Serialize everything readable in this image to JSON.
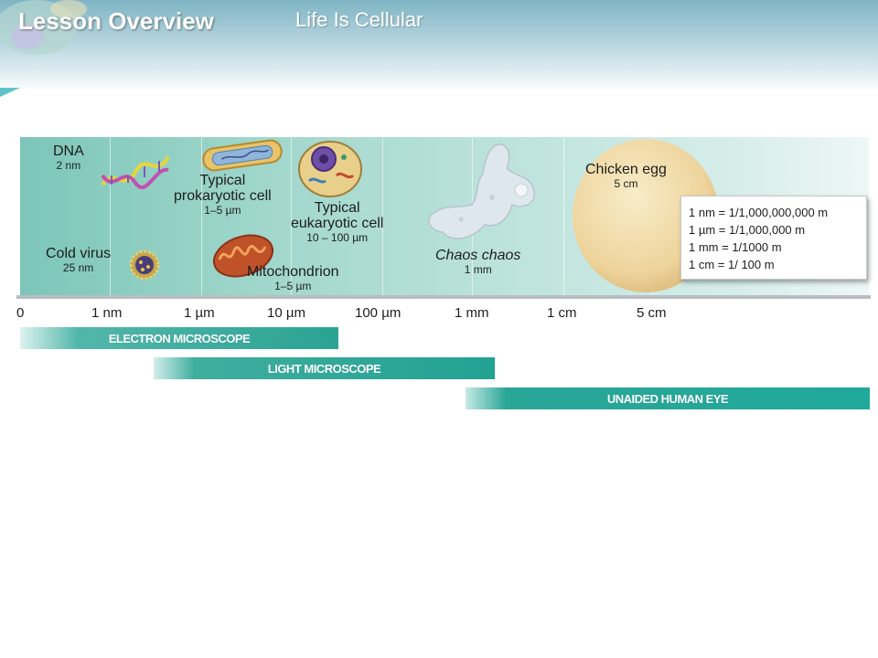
{
  "header": {
    "lesson_title": "Lesson Overview",
    "subtitle": "Life Is Cellular"
  },
  "figure": {
    "objects": [
      {
        "name": "DNA",
        "size": "2 nm"
      },
      {
        "name": "Cold virus",
        "size": "25 nm"
      },
      {
        "name": "Typical prokaryotic cell",
        "name_line1": "Typical",
        "name_line2": "prokaryotic cell",
        "size": "1–5 µm"
      },
      {
        "name": "Mitochondrion",
        "size": "1–5 µm"
      },
      {
        "name": "Typical eukaryotic cell",
        "name_line1": "Typical",
        "name_line2": "eukaryotic cell",
        "size": "10 – 100 µm"
      },
      {
        "name": "Chaos chaos",
        "size": "1 mm"
      },
      {
        "name": "Chicken egg",
        "size": "5 cm"
      }
    ],
    "scale_ticks": [
      "0",
      "1 nm",
      "1 µm",
      "10 µm",
      "100 µm",
      "1 mm",
      "1 cm",
      "5 cm"
    ],
    "units": [
      "1 nm = 1/1,000,000,000 m",
      "1 µm = 1/1,000,000 m",
      "1 mm = 1/1000 m",
      "1 cm = 1/ 100 m"
    ],
    "ranges": [
      {
        "label": "ELECTRON MICROSCOPE",
        "from": "0",
        "to": "100 µm"
      },
      {
        "label": "LIGHT MICROSCOPE",
        "from": "1 µm",
        "to": "1 mm"
      },
      {
        "label": "UNAIDED HUMAN EYE",
        "from": "1 mm",
        "to": "beyond 5 cm"
      }
    ],
    "colors": {
      "band_start": "#7cc6b9",
      "range_bar": "#1fa99a",
      "egg": "#f0d9a8"
    }
  }
}
